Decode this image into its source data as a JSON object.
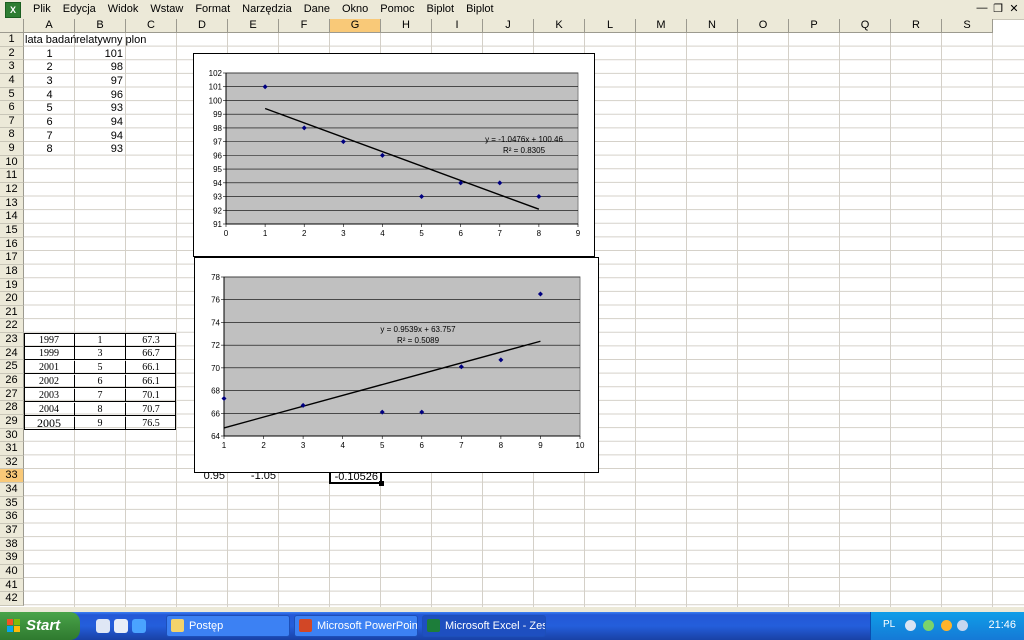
{
  "menubar": {
    "items": [
      "Plik",
      "Edycja",
      "Widok",
      "Wstaw",
      "Format",
      "Narzędzia",
      "Dane",
      "Okno",
      "Pomoc",
      "Biplot",
      "Biplot"
    ]
  },
  "columns": [
    "A",
    "B",
    "C",
    "D",
    "E",
    "F",
    "G",
    "H",
    "I",
    "J",
    "K",
    "L",
    "M",
    "N",
    "O",
    "P",
    "Q",
    "R",
    "S"
  ],
  "rows": [
    "1",
    "2",
    "3",
    "4",
    "5",
    "6",
    "7",
    "8",
    "9",
    "10",
    "11",
    "12",
    "13",
    "14",
    "15",
    "16",
    "17",
    "18",
    "19",
    "20",
    "21",
    "22",
    "23",
    "24",
    "25",
    "26",
    "27",
    "28",
    "29",
    "30",
    "31",
    "32",
    "33",
    "34",
    "35",
    "36",
    "37",
    "38",
    "39",
    "40",
    "41",
    "42"
  ],
  "selected": {
    "column": "G",
    "row": "33"
  },
  "sheet": {
    "header_a": "lata badań",
    "header_b": "relatywny plon",
    "table1": [
      [
        "1",
        "101"
      ],
      [
        "2",
        "98"
      ],
      [
        "3",
        "97"
      ],
      [
        "4",
        "96"
      ],
      [
        "5",
        "93"
      ],
      [
        "6",
        "94"
      ],
      [
        "7",
        "94"
      ],
      [
        "8",
        "93"
      ]
    ],
    "table2": [
      [
        "1997",
        "1",
        "67.3"
      ],
      [
        "1999",
        "3",
        "66.7"
      ],
      [
        "2001",
        "5",
        "66.1"
      ],
      [
        "2002",
        "6",
        "66.1"
      ],
      [
        "2003",
        "7",
        "70.1"
      ],
      [
        "2004",
        "8",
        "70.7"
      ],
      [
        "2005",
        "9",
        "76.5"
      ]
    ],
    "d33": "0.95",
    "e33": "-1.05",
    "g33": "-0.10526"
  },
  "chart_data": [
    {
      "type": "scatter",
      "x": [
        1,
        2,
        3,
        4,
        5,
        6,
        7,
        8
      ],
      "y": [
        101,
        98,
        97,
        96,
        93,
        94,
        94,
        93
      ],
      "xlim": [
        0,
        9
      ],
      "ylim": [
        91,
        102
      ],
      "trendline": {
        "slope": -1.0476,
        "intercept": 100.46,
        "x_range": [
          1,
          8
        ]
      },
      "equation": "y = -1.0476x + 100.46",
      "r2": "R² = 0.8305",
      "grid": true,
      "plot_bg": "#c0c0c0",
      "marker_color": "#000080"
    },
    {
      "type": "scatter",
      "x": [
        1,
        3,
        5,
        6,
        7,
        8,
        9
      ],
      "y": [
        67.3,
        66.7,
        66.1,
        66.1,
        70.1,
        70.7,
        76.5
      ],
      "xlim": [
        1,
        10
      ],
      "ylim": [
        64,
        78
      ],
      "ytick_step": 2,
      "trendline": {
        "slope": 0.9539,
        "intercept": 63.757,
        "x_range": [
          1,
          9
        ]
      },
      "equation": "y = 0.9539x + 63.757",
      "r2": "R² = 0.5089",
      "grid": true,
      "plot_bg": "#c0c0c0",
      "marker_color": "#000080"
    }
  ],
  "taskbar": {
    "start_label": "Start",
    "tasks": [
      {
        "label": "Postęp",
        "icon": "folder-icon"
      },
      {
        "label": "Microsoft PowerPoint ...",
        "icon": "powerpoint-icon"
      },
      {
        "label": "Microsoft Excel - Zesz...",
        "icon": "excel-icon"
      }
    ],
    "lang": "PL",
    "clock": "21:46"
  },
  "colors": {
    "menubar": "#ece9d8",
    "taskbar": "#245edb",
    "start": "#3c8e3c",
    "plot_bg": "#c0c0c0"
  }
}
